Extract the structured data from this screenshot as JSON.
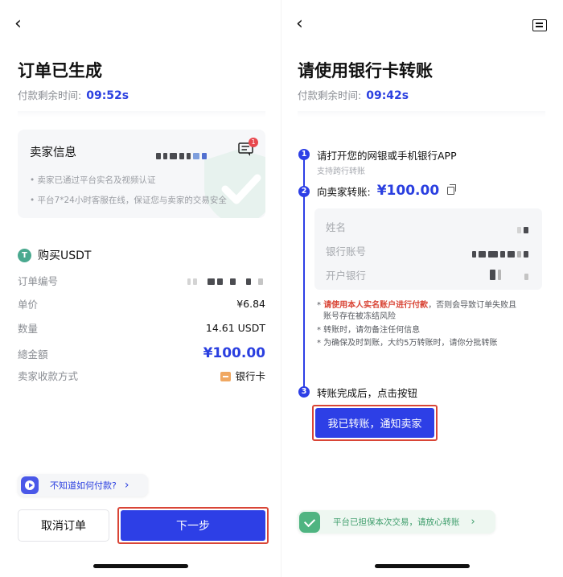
{
  "left": {
    "back_glyph": "‹",
    "title": "订单已生成",
    "timer_label": "付款剩余时间:",
    "timer_value": "09:52s",
    "seller": {
      "title": "卖家信息",
      "badge": "1",
      "notes": [
        "• 卖家已通过平台实名及视频认证",
        "• 平台7*24小时客服在线，保证您与卖家的交易安全"
      ]
    },
    "asset_icon": "T",
    "asset_label": "购买USDT",
    "rows": [
      {
        "label": "订单编号",
        "value": ""
      },
      {
        "label": "单价",
        "value": "¥6.84"
      },
      {
        "label": "数量",
        "value": "14.61 USDT"
      },
      {
        "label": "總金額",
        "value": "¥100.00"
      },
      {
        "label": "卖家收款方式",
        "value": "银行卡"
      }
    ],
    "help_text": "不知道如何付款?",
    "help_chevron": "›",
    "cancel_label": "取消订单",
    "next_label": "下一步"
  },
  "right": {
    "back_glyph": "‹",
    "title": "请使用银行卡转账",
    "timer_label": "付款剩余时间:",
    "timer_value": "09:42s",
    "steps": [
      {
        "num": "1",
        "text": "请打开您的网银或手机银行APP",
        "sub": "支持跨行转账"
      },
      {
        "num": "2",
        "text": "向卖家转账:",
        "amount": "¥100.00"
      },
      {
        "num": "3",
        "text": "转账完成后，点击按钮"
      }
    ],
    "bank_fields": [
      "姓名",
      "银行账号",
      "开户银行"
    ],
    "warnings": {
      "line1_red": "请使用本人实名账户进行付款",
      "line1_rest": "，否则会导致订单失败且",
      "line1_cont": "账号存在被冻结风险",
      "line2": "* 转账时，请勿备注任何信息",
      "line3": "* 为确保及时到账，大约5万转账时，请你分批转账",
      "bullet": "* "
    },
    "notify_label": "我已转账，通知卖家",
    "guarantee_text": "平台已担保本次交易，请放心转账",
    "guarantee_chevron": "›"
  },
  "icons": {
    "back": "chevron-left-icon",
    "chat": "chat-icon",
    "message": "message-icon",
    "usdt": "tether-icon",
    "bank": "bank-card-icon",
    "play": "play-icon",
    "copy": "copy-icon",
    "shield": "shield-check-icon"
  },
  "colors": {
    "accent": "#2d3fe6",
    "highlight_border": "#d94536",
    "warning_red": "#d94536",
    "guarantee_green": "#4fb481"
  }
}
